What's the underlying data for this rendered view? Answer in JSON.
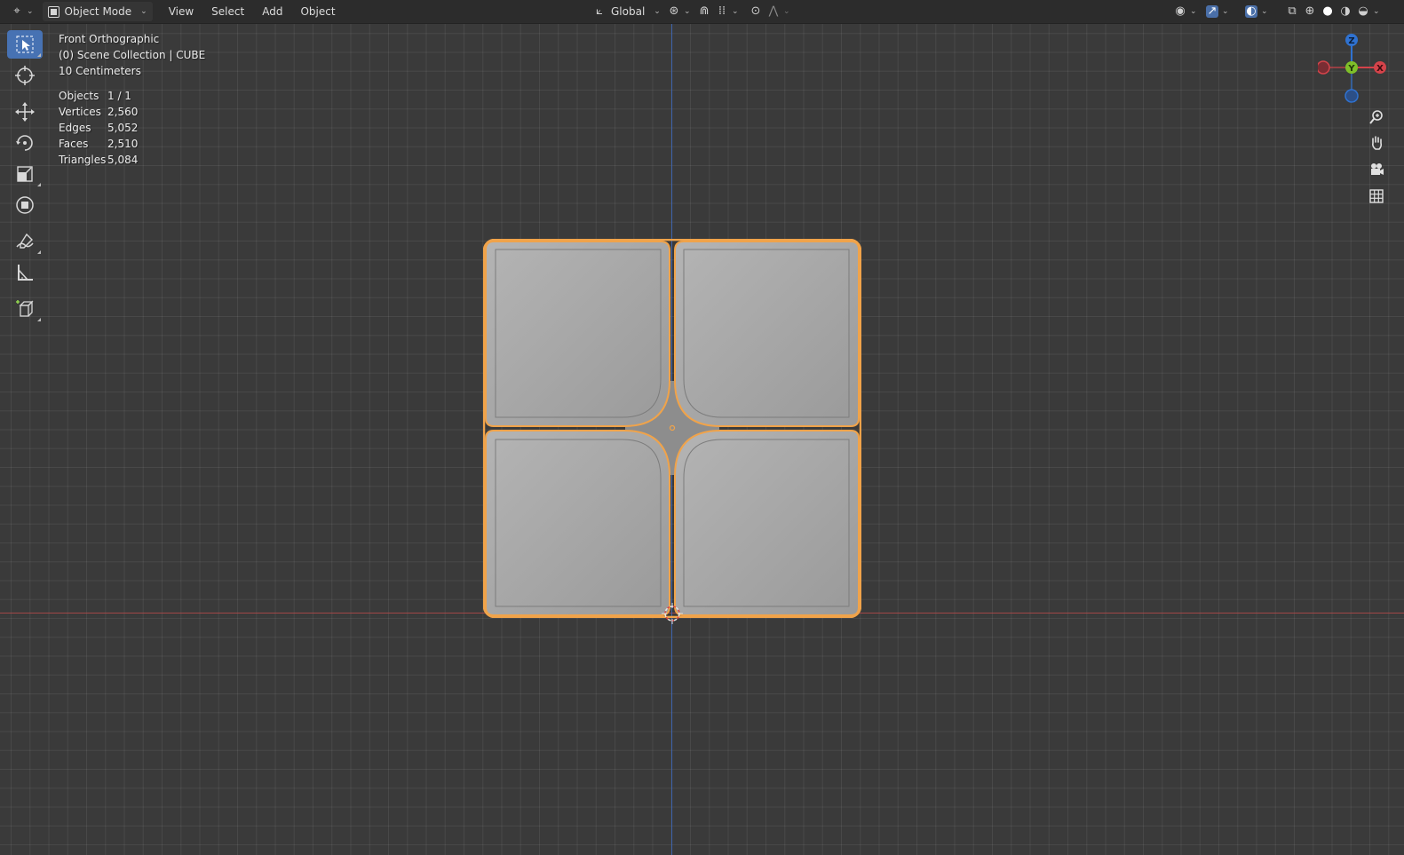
{
  "header": {
    "editor_type_icon": "viewport-editor-icon",
    "mode_label": "Object Mode",
    "menus": [
      "View",
      "Select",
      "Add",
      "Object"
    ],
    "transform_orientation": "Global"
  },
  "overlay": {
    "view_name": "Front Orthographic",
    "collection": "(0) Scene Collection | CUBE",
    "scale": "10 Centimeters",
    "stats": [
      {
        "label": "Objects",
        "value": "1 / 1"
      },
      {
        "label": "Vertices",
        "value": "2,560"
      },
      {
        "label": "Edges",
        "value": "5,052"
      },
      {
        "label": "Faces",
        "value": "2,510"
      },
      {
        "label": "Triangles",
        "value": "5,084"
      }
    ]
  },
  "gizmo": {
    "z": "Z",
    "y": "Y",
    "x": "X"
  },
  "colors": {
    "x_axis": "#d4434a",
    "y_axis": "#7fbf29",
    "z_axis": "#2f72d1",
    "selection_outline": "#f0a34a",
    "tool_active": "#4772b3"
  },
  "tools": [
    {
      "name": "select-box-tool",
      "icon": "cursor-select-icon",
      "selected": true
    },
    {
      "name": "cursor-tool",
      "icon": "3d-cursor-icon"
    },
    {
      "name": "move-tool",
      "icon": "move-icon"
    },
    {
      "name": "rotate-tool",
      "icon": "rotate-icon"
    },
    {
      "name": "scale-tool",
      "icon": "scale-icon"
    },
    {
      "name": "transform-tool",
      "icon": "transform-icon"
    },
    {
      "name": "annotate-tool",
      "icon": "annotate-pencil-icon"
    },
    {
      "name": "measure-tool",
      "icon": "measure-ruler-icon"
    },
    {
      "name": "add-cube-tool",
      "icon": "add-cube-icon"
    }
  ]
}
